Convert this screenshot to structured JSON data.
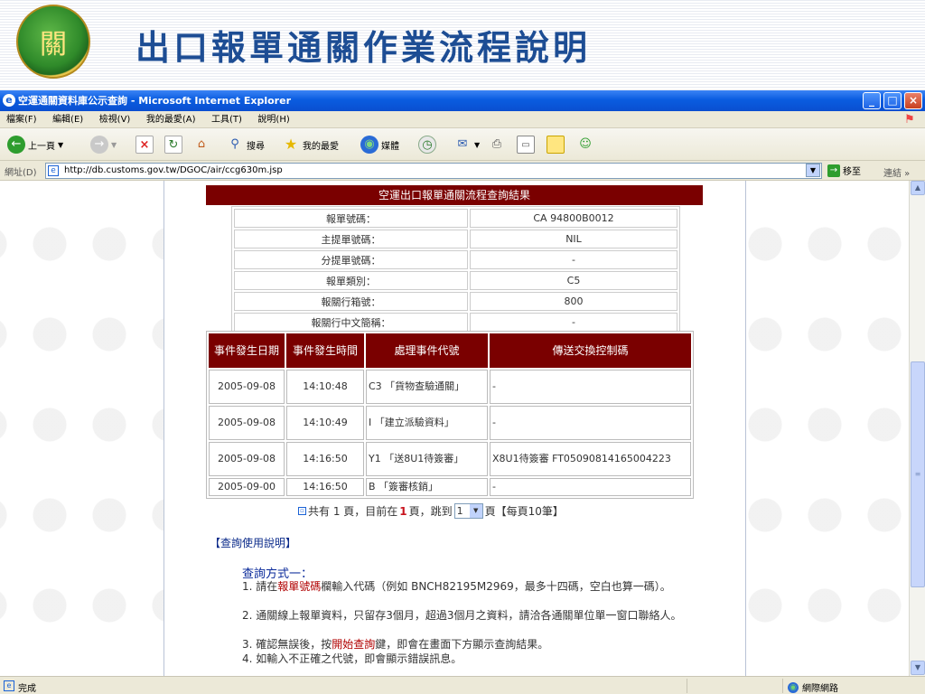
{
  "slide": {
    "title": "出口報單通關作業流程說明",
    "logo_mark": "關"
  },
  "window": {
    "title": "空運通關資料庫公示查詢 - Microsoft Internet Explorer",
    "minimize": "_",
    "maximize": "□",
    "close": "×"
  },
  "menu": {
    "items": [
      "檔案(F)",
      "編輯(E)",
      "檢視(V)",
      "我的最愛(A)",
      "工具(T)",
      "說明(H)"
    ]
  },
  "toolbar": {
    "back_label": "上一頁",
    "search_label": "搜尋",
    "favorites_label": "我的最愛",
    "media_label": "媒體"
  },
  "address": {
    "label": "網址(D)",
    "url": "http://db.customs.gov.tw/DGOC/air/ccg630m.jsp",
    "go_label": "移至",
    "links_label": "連結"
  },
  "result": {
    "title": "空運出口報單通關流程查詢結果",
    "info": [
      {
        "label": "報單號碼：",
        "value": "CA 94800B0012"
      },
      {
        "label": "主提單號碼：",
        "value": "NIL"
      },
      {
        "label": "分提單號碼：",
        "value": "-"
      },
      {
        "label": "報單類別：",
        "value": "C5"
      },
      {
        "label": "報關行箱號：",
        "value": "800"
      },
      {
        "label": "報關行中文簡稱：",
        "value": "-"
      }
    ],
    "event_headers": [
      "事件發生日期",
      "事件發生時間",
      "處理事件代號",
      "傳送交換控制碼"
    ],
    "events": [
      {
        "date": "2005-09-08",
        "time": "14:10:48",
        "code": "C3 「貨物查驗通關」",
        "control": "-"
      },
      {
        "date": "2005-09-08",
        "time": "14:10:49",
        "code": "I 「建立派驗資料」",
        "control": "-"
      },
      {
        "date": "2005-09-08",
        "time": "14:16:50",
        "code": "Y1 「送8U1待簽審」",
        "control": "X8U1待簽審 FT05090814165004223"
      },
      {
        "date": "2005-09-00",
        "time": "14:16:50",
        "code": "B 「簽審核銷」",
        "control": "-"
      }
    ]
  },
  "pager": {
    "prefix": "共有 1 頁，目前在",
    "current": "1",
    "middle": "頁，跳到",
    "select_value": "1",
    "suffix": "頁【每頁10筆】"
  },
  "help": {
    "heading": "【查詢使用說明】",
    "method_title": "查詢方式一：",
    "line1_a": "1. 請在",
    "line1_em": "報單號碼",
    "line1_b": "欄輸入代碼（例如 BNCH82195M2969，最多十四碼，空白也算一碼）。",
    "line2": "2. 通關線上報單資料，只留存3個月，超過3個月之資料，請洽各通關單位單一窗口聯絡人。",
    "line3_a": "3. 確認無誤後，按",
    "line3_em": "開始查詢",
    "line3_b": "鍵，即會在畫面下方顯示查詢結果。",
    "line4": "4. 如輸入不正確之代號，即會顯示錯誤訊息。"
  },
  "status": {
    "text": "完成",
    "zone": "網際網路"
  }
}
